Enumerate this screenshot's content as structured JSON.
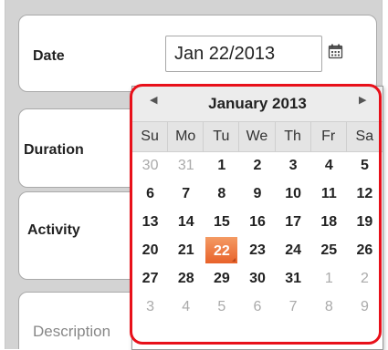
{
  "form": {
    "date_label": "Date",
    "date_value": "Jan 22/2013",
    "duration_label": "Duration",
    "activity_label": "Activity",
    "description_placeholder": "Description"
  },
  "calendar": {
    "month_title": "January 2013",
    "prev_icon": "triangle-left",
    "next_icon": "triangle-right",
    "weekdays": [
      "Su",
      "Mo",
      "Tu",
      "We",
      "Th",
      "Fr",
      "Sa"
    ],
    "weeks": [
      [
        {
          "d": "30",
          "other": true
        },
        {
          "d": "31",
          "other": true
        },
        {
          "d": "1"
        },
        {
          "d": "2"
        },
        {
          "d": "3"
        },
        {
          "d": "4"
        },
        {
          "d": "5"
        }
      ],
      [
        {
          "d": "6"
        },
        {
          "d": "7"
        },
        {
          "d": "8"
        },
        {
          "d": "9"
        },
        {
          "d": "10"
        },
        {
          "d": "11"
        },
        {
          "d": "12"
        }
      ],
      [
        {
          "d": "13"
        },
        {
          "d": "14"
        },
        {
          "d": "15"
        },
        {
          "d": "16"
        },
        {
          "d": "17"
        },
        {
          "d": "18"
        },
        {
          "d": "19"
        }
      ],
      [
        {
          "d": "20"
        },
        {
          "d": "21"
        },
        {
          "d": "22",
          "selected": true
        },
        {
          "d": "23"
        },
        {
          "d": "24"
        },
        {
          "d": "25"
        },
        {
          "d": "26"
        }
      ],
      [
        {
          "d": "27"
        },
        {
          "d": "28"
        },
        {
          "d": "29"
        },
        {
          "d": "30"
        },
        {
          "d": "31"
        },
        {
          "d": "1",
          "other": true
        },
        {
          "d": "2",
          "other": true
        }
      ],
      [
        {
          "d": "3",
          "other": true
        },
        {
          "d": "4",
          "other": true
        },
        {
          "d": "5",
          "other": true
        },
        {
          "d": "6",
          "other": true
        },
        {
          "d": "7",
          "other": true
        },
        {
          "d": "8",
          "other": true
        },
        {
          "d": "9",
          "other": true
        }
      ]
    ]
  },
  "colors": {
    "selected_day": "#e8622a",
    "highlight_ring": "#e8101a",
    "frame_background": "#d3d3d3"
  }
}
